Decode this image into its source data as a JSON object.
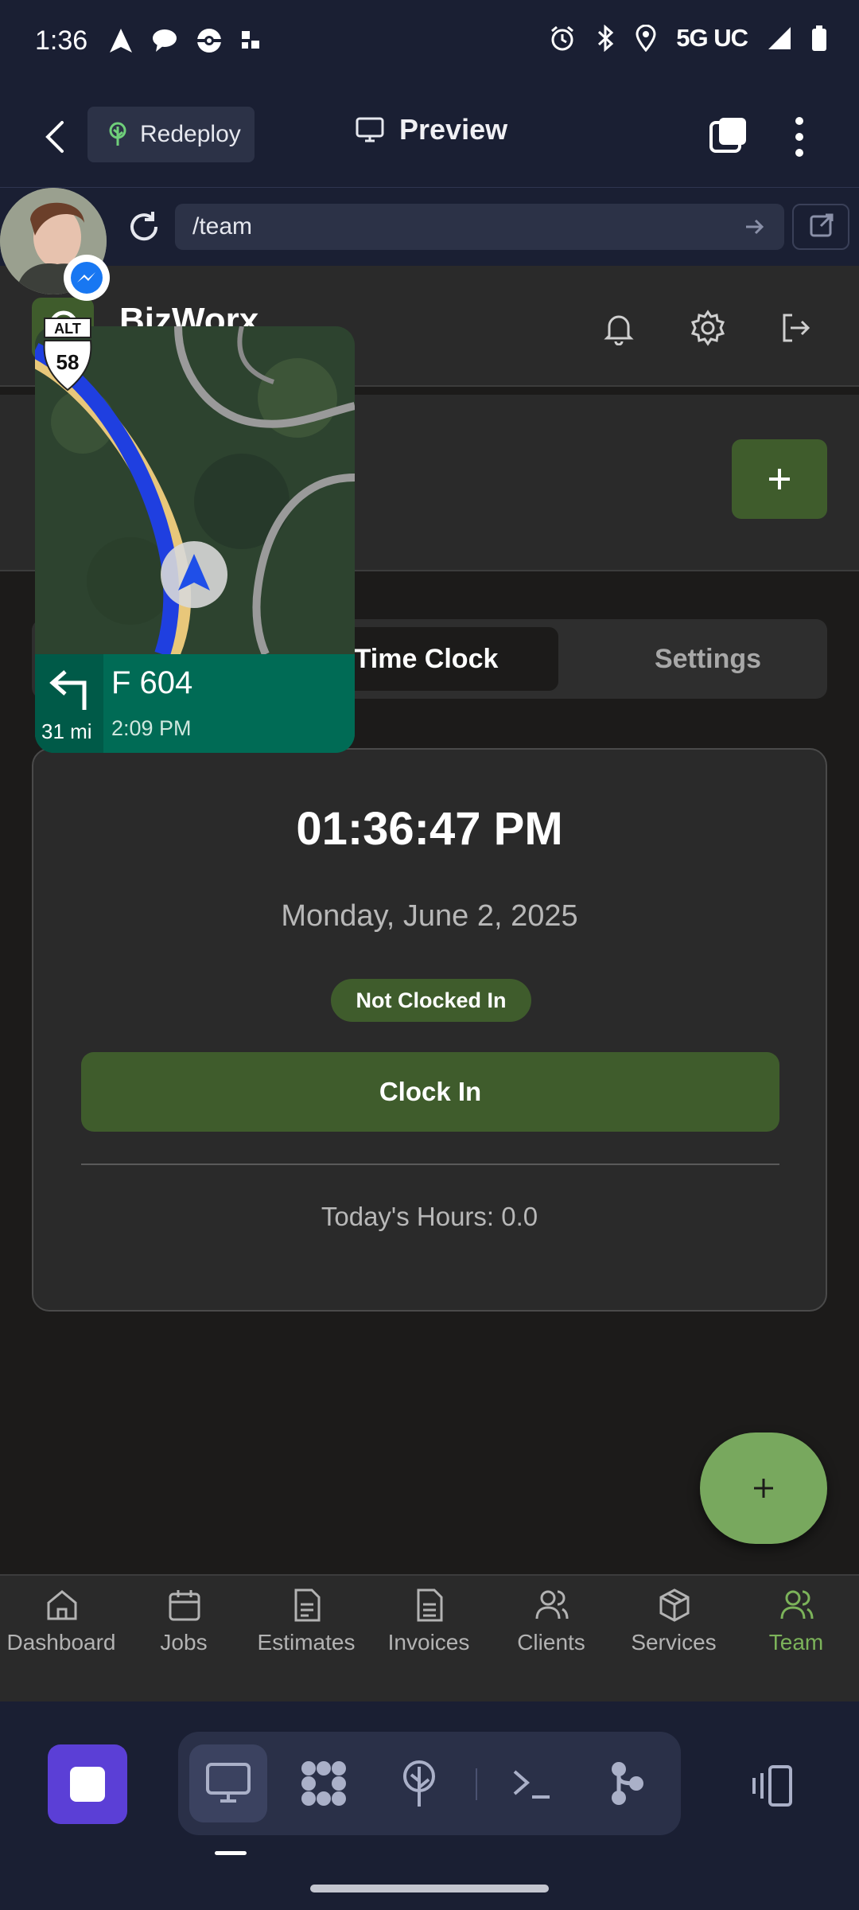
{
  "status_bar": {
    "time": "1:36",
    "network": "5G UC"
  },
  "app_header": {
    "redeploy_label": "Redeploy",
    "preview_label": "Preview"
  },
  "url_bar": {
    "path": "/team"
  },
  "web_app": {
    "brand": "BizWorx",
    "tabs": [
      {
        "label": "Time Clock",
        "active": true
      },
      {
        "label": "Settings",
        "active": false
      }
    ],
    "time_clock": {
      "time": "01:36:47 PM",
      "date": "Monday, June 2, 2025",
      "status": "Not Clocked In",
      "clock_in_label": "Clock In",
      "todays_hours": "Today's Hours: 0.0"
    }
  },
  "bottom_nav": [
    {
      "label": "Dashboard",
      "icon": "home-icon"
    },
    {
      "label": "Jobs",
      "icon": "calendar-icon"
    },
    {
      "label": "Estimates",
      "icon": "document-icon"
    },
    {
      "label": "Invoices",
      "icon": "invoice-icon"
    },
    {
      "label": "Clients",
      "icon": "users-icon"
    },
    {
      "label": "Services",
      "icon": "package-icon"
    },
    {
      "label": "Team",
      "icon": "team-icon",
      "active": true
    }
  ],
  "navigation_overlay": {
    "shield_top": "ALT",
    "shield_number": "58",
    "road": "F 604",
    "distance": "31 mi",
    "eta": "2:09 PM"
  },
  "colors": {
    "accent_green": "#3f5c2c",
    "fab_green": "#78a85e",
    "active_nav": "#7cb35a",
    "system_bar": "#1a1f33"
  }
}
